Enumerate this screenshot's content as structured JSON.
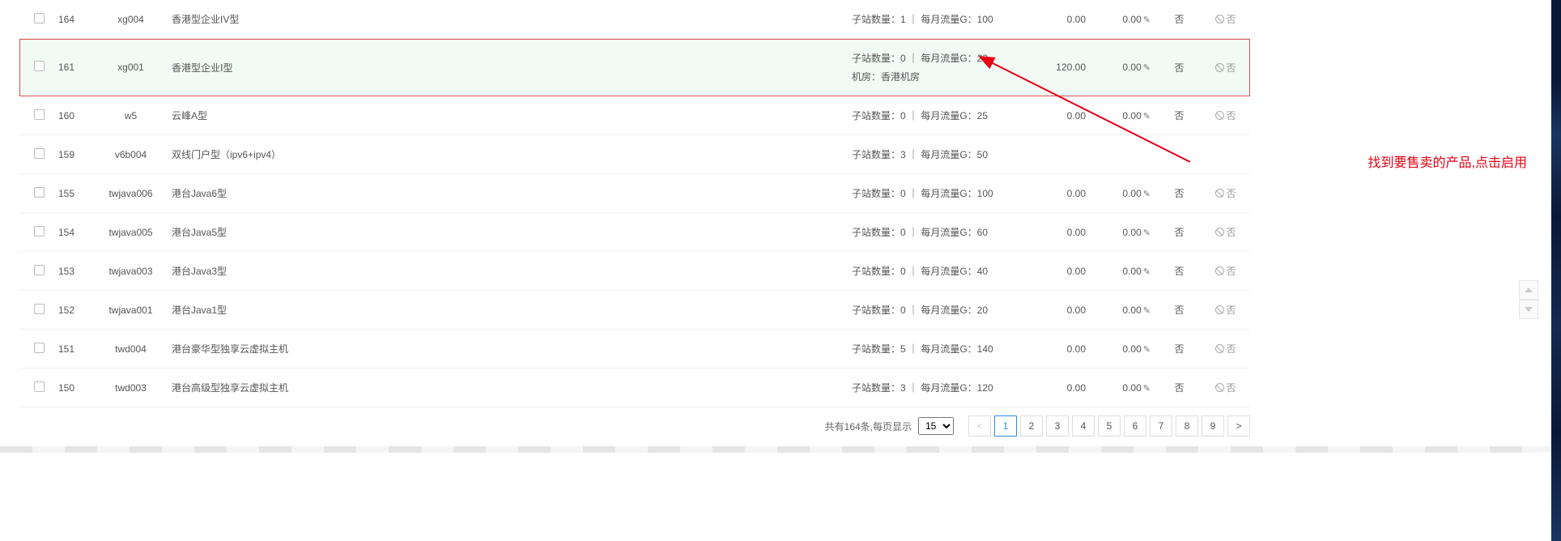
{
  "annotation": "找到要售卖的产品,点击启用",
  "rows": [
    {
      "id": "164",
      "code": "xg004",
      "name": "香港型企业IV型",
      "info": "子站数量：1 ｜ 每月流量G：100",
      "info2": "",
      "num1": "0.00",
      "num2": "0.00",
      "flag": "否",
      "action": "否",
      "highlight": false
    },
    {
      "id": "161",
      "code": "xg001",
      "name": "香港型企业Ⅰ型",
      "info": "子站数量：0 ｜ 每月流量G：20",
      "info2": "机房：香港机房",
      "num1": "120.00",
      "num2": "0.00",
      "flag": "否",
      "action": "否",
      "highlight": true
    },
    {
      "id": "160",
      "code": "w5",
      "name": "云峰A型",
      "info": "子站数量：0 ｜ 每月流量G：25",
      "info2": "",
      "num1": "0.00",
      "num2": "0.00",
      "flag": "否",
      "action": "否",
      "highlight": false
    },
    {
      "id": "159",
      "code": "v6b004",
      "name": "双线门户型（ipv6+ipv4）",
      "info": "子站数量：3 ｜ 每月流量G：50",
      "info2": "",
      "num1": "",
      "num2": "",
      "flag": "",
      "action": "",
      "highlight": false
    },
    {
      "id": "155",
      "code": "twjava006",
      "name": "港台Java6型",
      "info": "子站数量：0 ｜ 每月流量G：100",
      "info2": "",
      "num1": "0.00",
      "num2": "0.00",
      "flag": "否",
      "action": "否",
      "highlight": false
    },
    {
      "id": "154",
      "code": "twjava005",
      "name": "港台Java5型",
      "info": "子站数量：0 ｜ 每月流量G：60",
      "info2": "",
      "num1": "0.00",
      "num2": "0.00",
      "flag": "否",
      "action": "否",
      "highlight": false
    },
    {
      "id": "153",
      "code": "twjava003",
      "name": "港台Java3型",
      "info": "子站数量：0 ｜ 每月流量G：40",
      "info2": "",
      "num1": "0.00",
      "num2": "0.00",
      "flag": "否",
      "action": "否",
      "highlight": false
    },
    {
      "id": "152",
      "code": "twjava001",
      "name": "港台Java1型",
      "info": "子站数量：0 ｜ 每月流量G：20",
      "info2": "",
      "num1": "0.00",
      "num2": "0.00",
      "flag": "否",
      "action": "否",
      "highlight": false
    },
    {
      "id": "151",
      "code": "twd004",
      "name": "港台豪华型独享云虚拟主机",
      "info": "子站数量：5 ｜ 每月流量G：140",
      "info2": "",
      "num1": "0.00",
      "num2": "0.00",
      "flag": "否",
      "action": "否",
      "highlight": false
    },
    {
      "id": "150",
      "code": "twd003",
      "name": "港台高级型独享云虚拟主机",
      "info": "子站数量：3 ｜ 每月流量G：120",
      "info2": "",
      "num1": "0.00",
      "num2": "0.00",
      "flag": "否",
      "action": "否",
      "highlight": false
    }
  ],
  "footer": {
    "total_text": "共有164条,每页显示",
    "per_page": "15",
    "pages": [
      "1",
      "2",
      "3",
      "4",
      "5",
      "6",
      "7",
      "8",
      "9"
    ],
    "active_page": "1",
    "prev": "<",
    "next": ">"
  }
}
